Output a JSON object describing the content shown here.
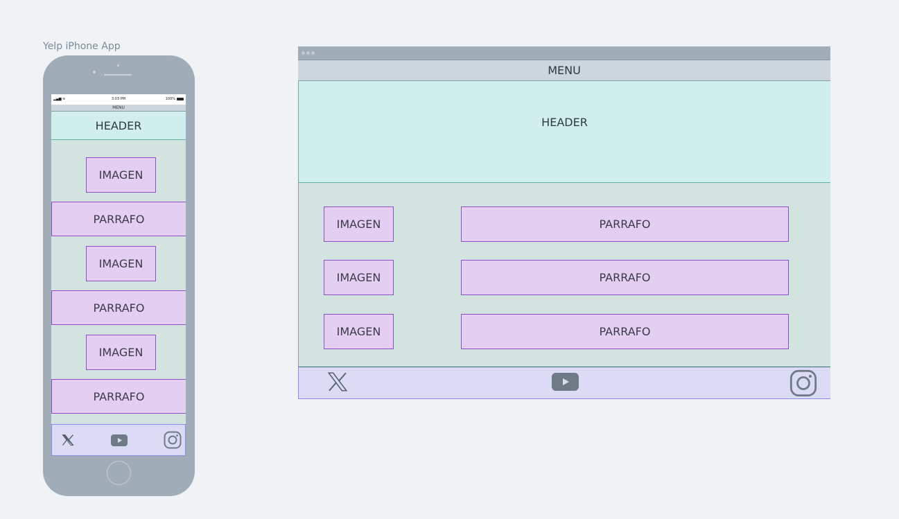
{
  "canvas_label": "Yelp iPhone App",
  "phone": {
    "status": {
      "time": "3:03 PM",
      "battery": "100%"
    },
    "menu": "MENU",
    "header": "HEADER",
    "sections": [
      {
        "image": "IMAGEN",
        "paragraph": "PARRAFO"
      },
      {
        "image": "IMAGEN",
        "paragraph": "PARRAFO"
      },
      {
        "image": "IMAGEN",
        "paragraph": "PARRAFO"
      }
    ],
    "footer_icons": [
      "x-logo-icon",
      "youtube-icon",
      "instagram-icon"
    ]
  },
  "desktop": {
    "menu": "MENU",
    "header": "HEADER",
    "rows": [
      {
        "image": "IMAGEN",
        "paragraph": "PARRAFO"
      },
      {
        "image": "IMAGEN",
        "paragraph": "PARRAFO"
      },
      {
        "image": "IMAGEN",
        "paragraph": "PARRAFO"
      }
    ],
    "footer_icons": [
      "x-logo-icon",
      "youtube-icon",
      "instagram-icon"
    ]
  },
  "colors": {
    "canvas": "#f0f3f6",
    "device": "#a0adb9",
    "menu_bar": "#cdd5dd",
    "header": "#d0eeeb",
    "content": "#d2e3e0",
    "box_fill": "#e4cff3",
    "box_border": "#8a50c9",
    "footer": "#dcdbf5",
    "icon": "#6e7a86"
  }
}
